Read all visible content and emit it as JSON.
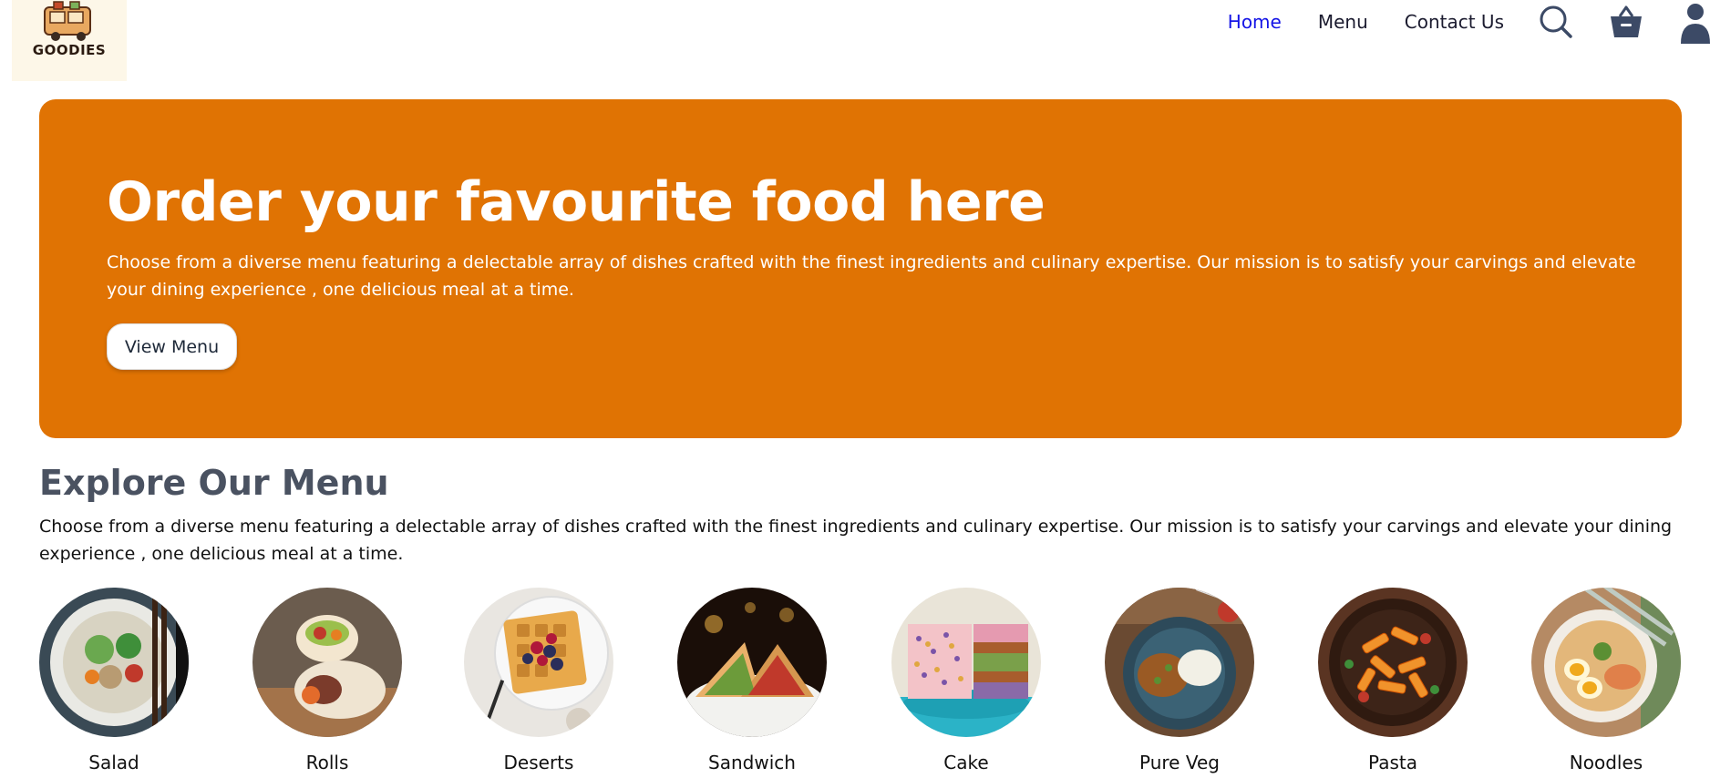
{
  "brand": {
    "name": "GOODIES"
  },
  "nav": {
    "links": [
      {
        "label": "Home",
        "active": true
      },
      {
        "label": "Menu",
        "active": false
      },
      {
        "label": "Contact Us",
        "active": false
      }
    ],
    "icons": [
      "search-icon",
      "basket-icon",
      "user-icon"
    ],
    "active_color": "#1414e6"
  },
  "hero": {
    "title": "Order your favourite food here",
    "description": "Choose from a diverse menu featuring a delectable array of dishes crafted with the finest ingredients and culinary expertise. Our mission is to satisfy your carvings and elevate your dining experience , one delicious meal at a time.",
    "button_label": "View Menu",
    "background_color": "#e07303"
  },
  "explore": {
    "title": "Explore Our Menu",
    "description": "Choose from a diverse menu featuring a delectable array of dishes crafted with the finest ingredients and culinary expertise. Our mission is to satisfy your carvings and elevate your dining experience , one delicious meal at a time.",
    "items": [
      {
        "label": "Salad"
      },
      {
        "label": "Rolls"
      },
      {
        "label": "Deserts"
      },
      {
        "label": "Sandwich"
      },
      {
        "label": "Cake"
      },
      {
        "label": "Pure Veg"
      },
      {
        "label": "Pasta"
      },
      {
        "label": "Noodles"
      }
    ]
  }
}
